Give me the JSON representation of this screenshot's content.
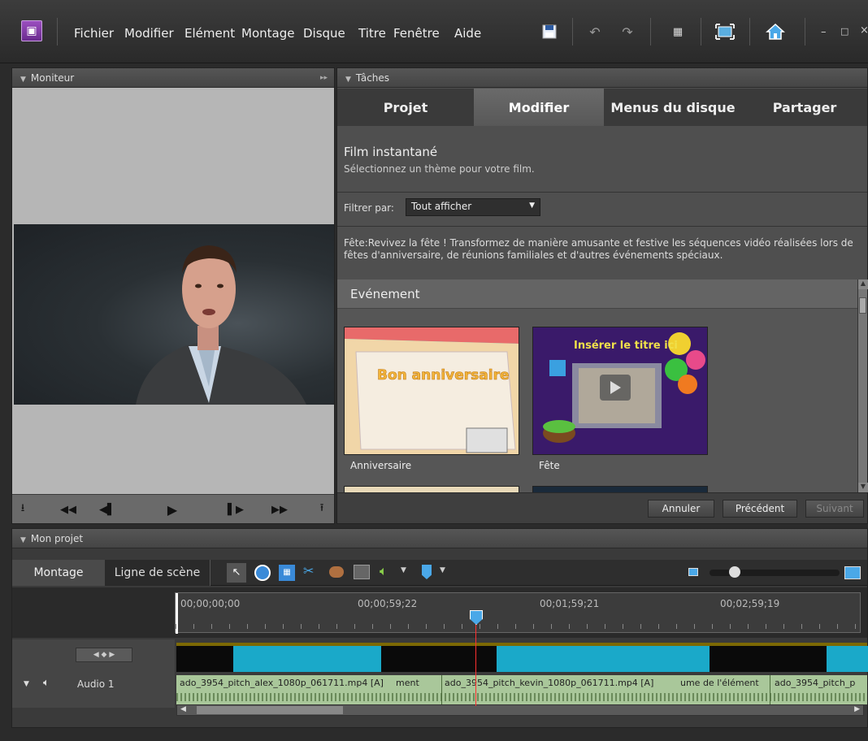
{
  "menubar": {
    "items": [
      "Fichier",
      "Modifier",
      "Elément",
      "Montage",
      "Disque",
      "Titre",
      "Fenêtre",
      "Aide"
    ],
    "window_controls": [
      "–",
      "□",
      "×"
    ],
    "icons": [
      "film-logo-icon",
      "save-icon",
      "undo-icon",
      "redo-icon",
      "grid-icon",
      "fullscreen-icon",
      "home-icon"
    ]
  },
  "monitor": {
    "title": "Moniteur"
  },
  "tasks": {
    "title": "Tâches",
    "tabs": [
      "Projet",
      "Modifier",
      "Menus du disque",
      "Partager"
    ],
    "active_tab": "Modifier",
    "section_title": "Film instantané",
    "section_subtitle": "Sélectionnez un thème pour votre film.",
    "filter_label": "Filtrer par:",
    "filter_value": "Tout afficher",
    "description": "Fête:Revivez la fête ! Transformez de manière amusante et festive les séquences vidéo réalisées lors de fêtes d'anniversaire, de réunions familiales et d'autres événements spéciaux.",
    "category": "Evénement",
    "themes": [
      {
        "label": "Anniversaire",
        "thumb_text": "Bon anniversaire"
      },
      {
        "label": "Fête",
        "thumb_text": "Insérer le titre ici"
      }
    ],
    "buttons": {
      "cancel": "Annuler",
      "previous": "Précédent",
      "next": "Suivant"
    }
  },
  "project": {
    "title": "Mon projet",
    "tabs": [
      "Montage",
      "Ligne de scène"
    ],
    "active_tab": "Montage",
    "timecodes": [
      "00;00;00;00",
      "00;00;59;22",
      "00;01;59;21",
      "00;02;59;19"
    ],
    "audio_track_label": "Audio 1",
    "clips": [
      "ado_3954_pitch_alex_1080p_061711.mp4 [A]",
      "ment",
      "ado_3954_pitch_kevin_1080p_061711.mp4 [A]",
      "ume de l'élément",
      "ado_3954_pitch_p"
    ]
  },
  "colors": {
    "accent_tab": "#5a5a5a",
    "video_clip": "#1aa9c9",
    "audio_clip": "#a9c79a",
    "playhead": "#ff3030"
  }
}
